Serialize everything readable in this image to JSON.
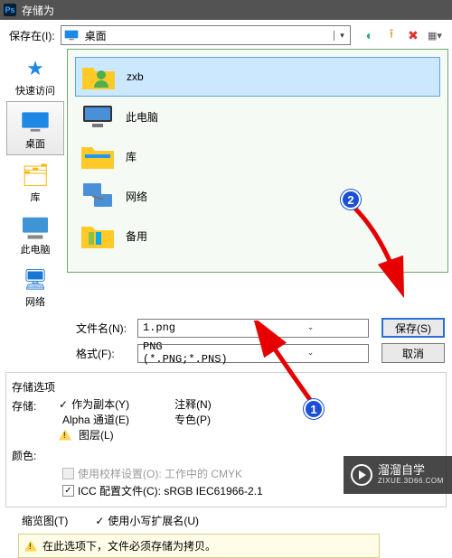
{
  "titlebar": {
    "title": "存储为"
  },
  "lookin": {
    "label": "保存在(I):",
    "value": "桌面"
  },
  "places": {
    "quick": "快速访问",
    "desktop": "桌面",
    "library": "库",
    "thispc": "此电脑",
    "network": "网络",
    "selected": "desktop"
  },
  "files": {
    "items": [
      {
        "name": "zxb",
        "type": "folder-user",
        "selected": true
      },
      {
        "name": "此电脑",
        "type": "pc"
      },
      {
        "name": "库",
        "type": "libs"
      },
      {
        "name": "网络",
        "type": "net"
      },
      {
        "name": "备用",
        "type": "folder"
      }
    ]
  },
  "filename": {
    "label": "文件名(N):",
    "value": "1.png"
  },
  "format": {
    "label": "格式(F):",
    "value": "PNG (*.PNG;*.PNS)"
  },
  "buttons": {
    "save": "保存(S)",
    "cancel": "取消"
  },
  "options": {
    "storage_title": "存储选项",
    "storage_label": "存储:",
    "as_copy": "作为副本(Y)",
    "notes": "注释(N)",
    "alpha": "Alpha 通道(E)",
    "spot": "专色(P)",
    "layers": "图层(L)",
    "color_title": "颜色:",
    "proof": "使用校样设置(O): 工作中的 CMYK",
    "icc": "ICC 配置文件(C): sRGB IEC61966-2.1"
  },
  "bottom": {
    "thumbnail": "缩览图(T)",
    "lowercase": "使用小写扩展名(U)"
  },
  "note": "在此选项下，文件必须存储为拷贝。",
  "watermark": {
    "brand": "溜溜自学",
    "url": "ZIXUE.3D66.COM"
  },
  "annotations": {
    "badge1": "1",
    "badge2": "2"
  }
}
